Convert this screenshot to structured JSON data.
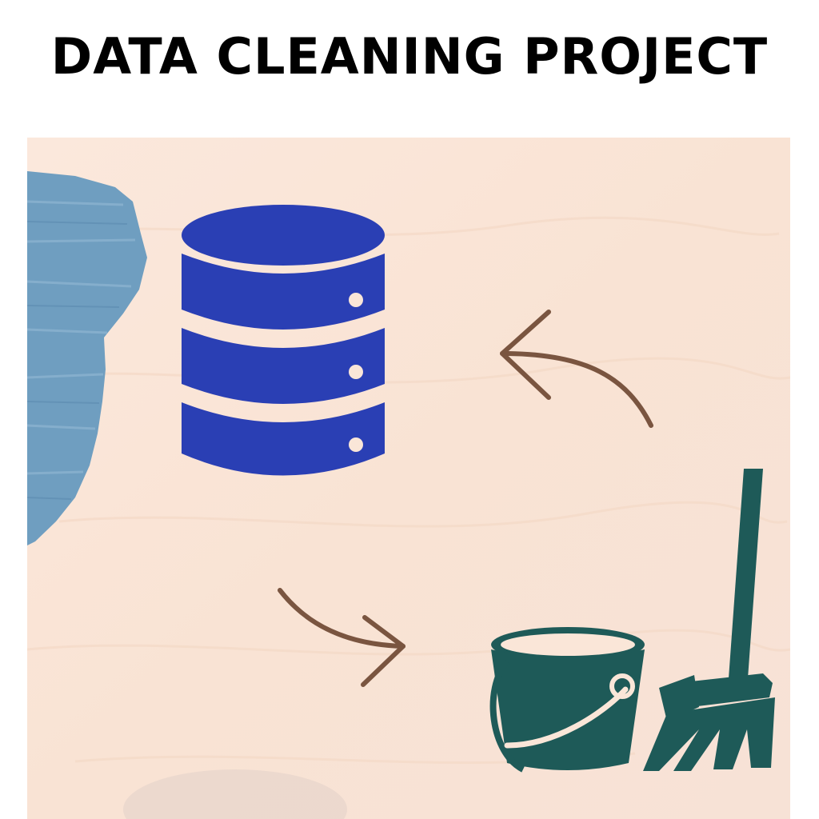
{
  "header": {
    "title": "DATA CLEANING PROJECT"
  },
  "illustration": {
    "icons": [
      "database-icon",
      "curved-arrow-back-icon",
      "curved-arrow-forward-icon",
      "bucket-icon",
      "broom-icon"
    ],
    "colors": {
      "background": "#fae6d8",
      "paint_stroke": "#6f9ec0",
      "database": "#2a3fb4",
      "arrows": "#7a5540",
      "cleaning_tools": "#1e5a58"
    }
  }
}
